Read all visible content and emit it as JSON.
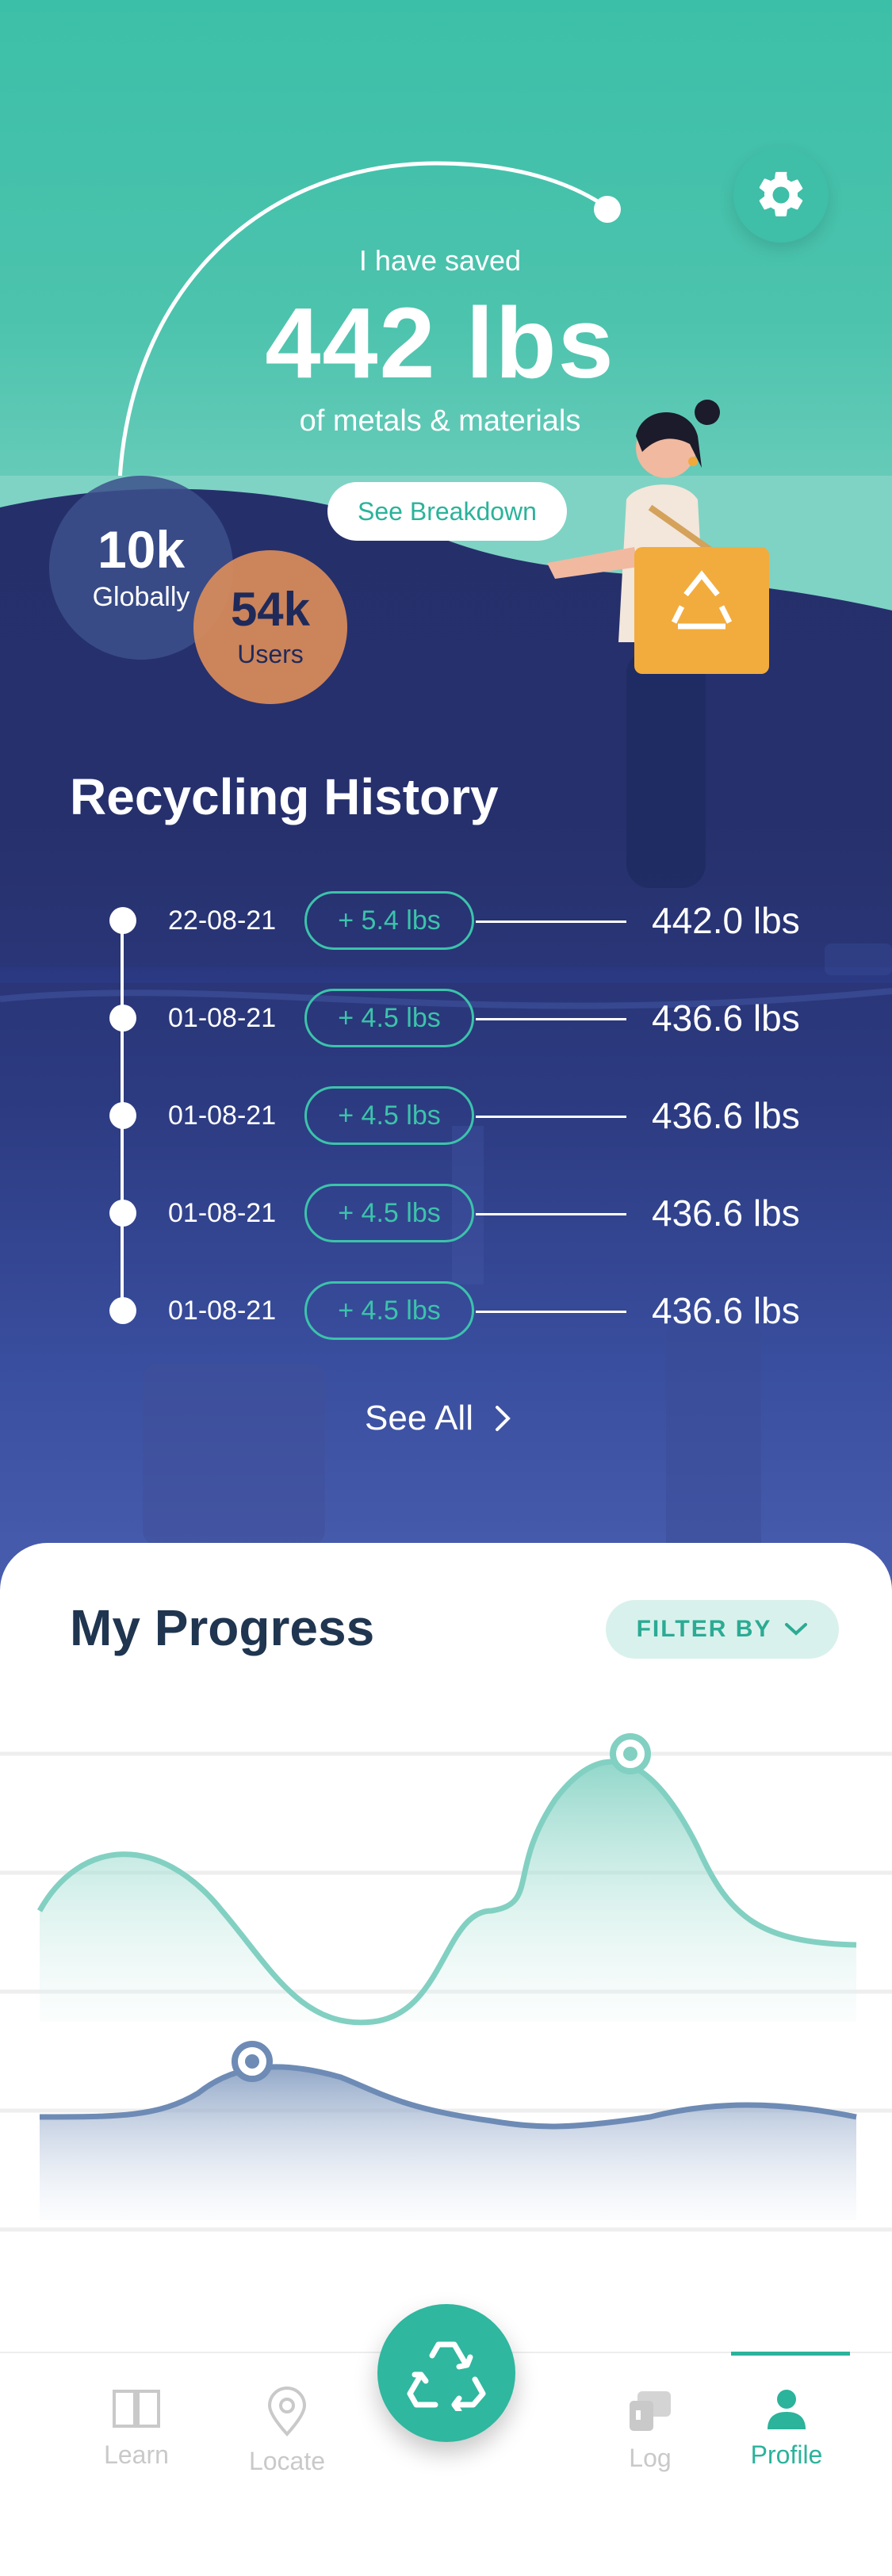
{
  "colors": {
    "accent": "#2bb39b",
    "navy": "#25306b",
    "orange": "#da8c5a"
  },
  "hero": {
    "saved_label": "I have saved",
    "saved_amount": "442 lbs",
    "saved_subtitle": "of metals & materials",
    "breakdown_label": "See Breakdown",
    "settings_icon": "gear-icon"
  },
  "stats": {
    "global_value": "10k",
    "global_label": "Globally",
    "users_value": "54k",
    "users_label": "Users"
  },
  "history": {
    "title": "Recycling History",
    "rows": [
      {
        "date": "22-08-21",
        "delta": "+ 5.4 lbs",
        "total": "442.0 lbs"
      },
      {
        "date": "01-08-21",
        "delta": "+ 4.5 lbs",
        "total": "436.6 lbs"
      },
      {
        "date": "01-08-21",
        "delta": "+ 4.5 lbs",
        "total": "436.6 lbs"
      },
      {
        "date": "01-08-21",
        "delta": "+ 4.5 lbs",
        "total": "436.6 lbs"
      },
      {
        "date": "01-08-21",
        "delta": "+ 4.5 lbs",
        "total": "436.6 lbs"
      }
    ],
    "see_all_label": "See All"
  },
  "progress": {
    "title": "My Progress",
    "filter_label": "FILTER BY"
  },
  "tabbar": {
    "items": [
      {
        "label": "Learn",
        "icon": "book-icon",
        "active": false
      },
      {
        "label": "Locate",
        "icon": "location-pin-icon",
        "active": false
      },
      {
        "label": "Log",
        "icon": "log-icon",
        "active": false
      },
      {
        "label": "Profile",
        "icon": "person-icon",
        "active": true
      }
    ],
    "center_icon": "recycle-icon"
  }
}
